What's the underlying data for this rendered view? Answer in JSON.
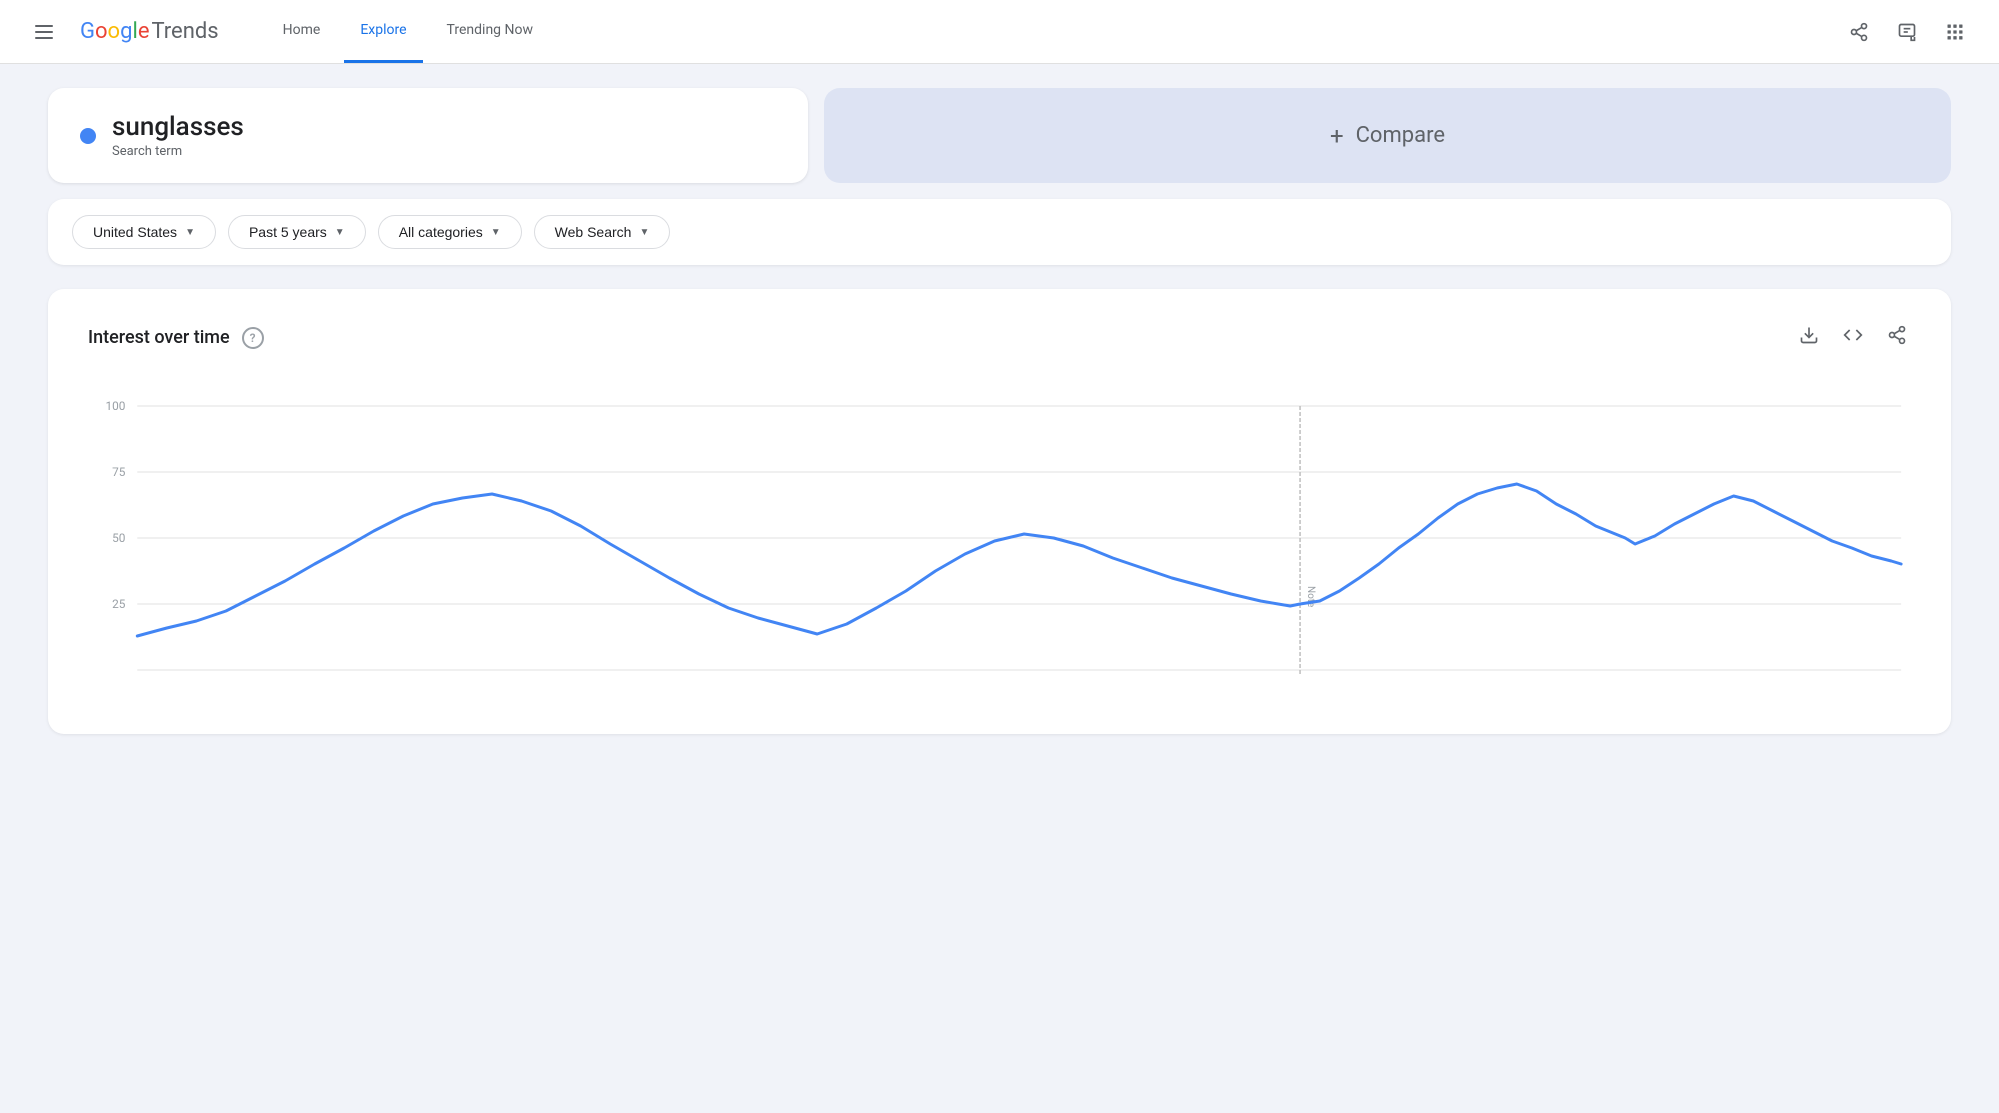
{
  "header": {
    "hamburger_label": "☰",
    "logo_google": "Google",
    "logo_trends": "Trends",
    "nav": [
      {
        "label": "Home",
        "active": false
      },
      {
        "label": "Explore",
        "active": true
      },
      {
        "label": "Trending Now",
        "active": false
      }
    ],
    "actions": {
      "share_icon": "share",
      "chat_icon": "chat",
      "apps_icon": "apps"
    }
  },
  "search": {
    "term": "sunglasses",
    "subtitle": "Search term",
    "dot_color": "#4285f4"
  },
  "compare": {
    "plus": "+",
    "label": "Compare"
  },
  "filters": [
    {
      "label": "United States",
      "id": "region"
    },
    {
      "label": "Past 5 years",
      "id": "time"
    },
    {
      "label": "All categories",
      "id": "category"
    },
    {
      "label": "Web Search",
      "id": "type"
    }
  ],
  "chart": {
    "title": "Interest over time",
    "help": "?",
    "y_labels": [
      "100",
      "75",
      "50",
      "25"
    ],
    "note": "Note",
    "line_color": "#4285f4",
    "grid_color": "#e0e0e0"
  }
}
